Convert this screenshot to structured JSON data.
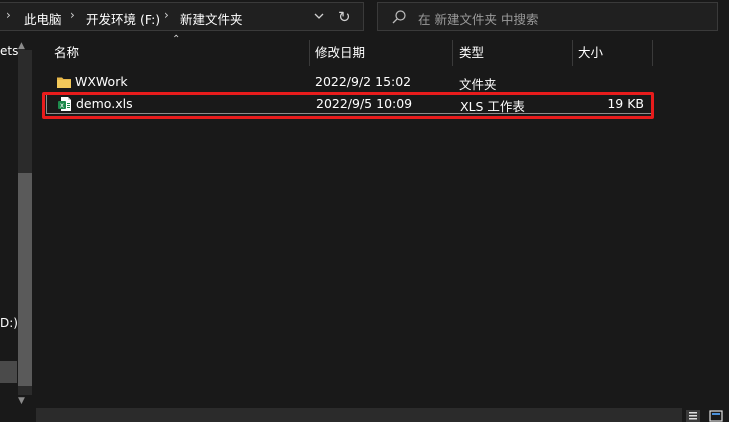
{
  "address_bar": {
    "crumbs": [
      "此电脑",
      "开发环境 (F:)",
      "新建文件夹"
    ]
  },
  "search": {
    "placeholder": "在 新建文件夹 中搜索"
  },
  "nav": {
    "partial_items": [
      "ets",
      "D:)"
    ]
  },
  "columns": {
    "name": "名称",
    "modified": "修改日期",
    "type": "类型",
    "size": "大小"
  },
  "files": [
    {
      "name": "WXWork",
      "modified": "2022/9/2 15:02",
      "type": "文件夹",
      "size": "",
      "icon": "folder-icon"
    },
    {
      "name": "demo.xls",
      "modified": "2022/9/5 10:09",
      "type": "XLS 工作表",
      "size": "19 KB",
      "icon": "excel-file-icon"
    }
  ],
  "colors": {
    "background": "#191919",
    "highlight_box": "#e81c1c",
    "folder": "#f3c95a"
  }
}
